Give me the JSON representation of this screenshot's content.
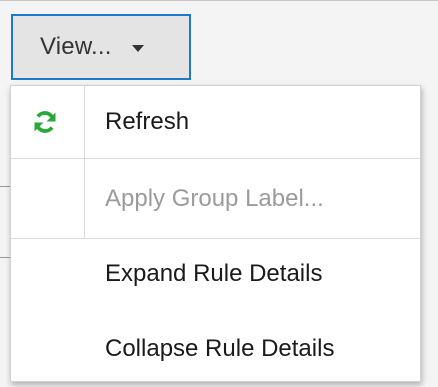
{
  "view_button": {
    "label": "View...",
    "caret_icon": "caret-down-icon"
  },
  "menu": {
    "items": [
      {
        "label": "Refresh",
        "icon": "refresh-icon",
        "icon_color": "#2aa83a",
        "enabled": true
      },
      {
        "label": "Apply Group Label...",
        "enabled": false
      },
      {
        "label": "Expand Rule Details",
        "enabled": true
      },
      {
        "label": "Collapse Rule Details",
        "enabled": true
      }
    ]
  },
  "colors": {
    "focus_border": "#1f78c8",
    "disabled_text": "#9b9b9b",
    "refresh_icon": "#2aa83a"
  }
}
